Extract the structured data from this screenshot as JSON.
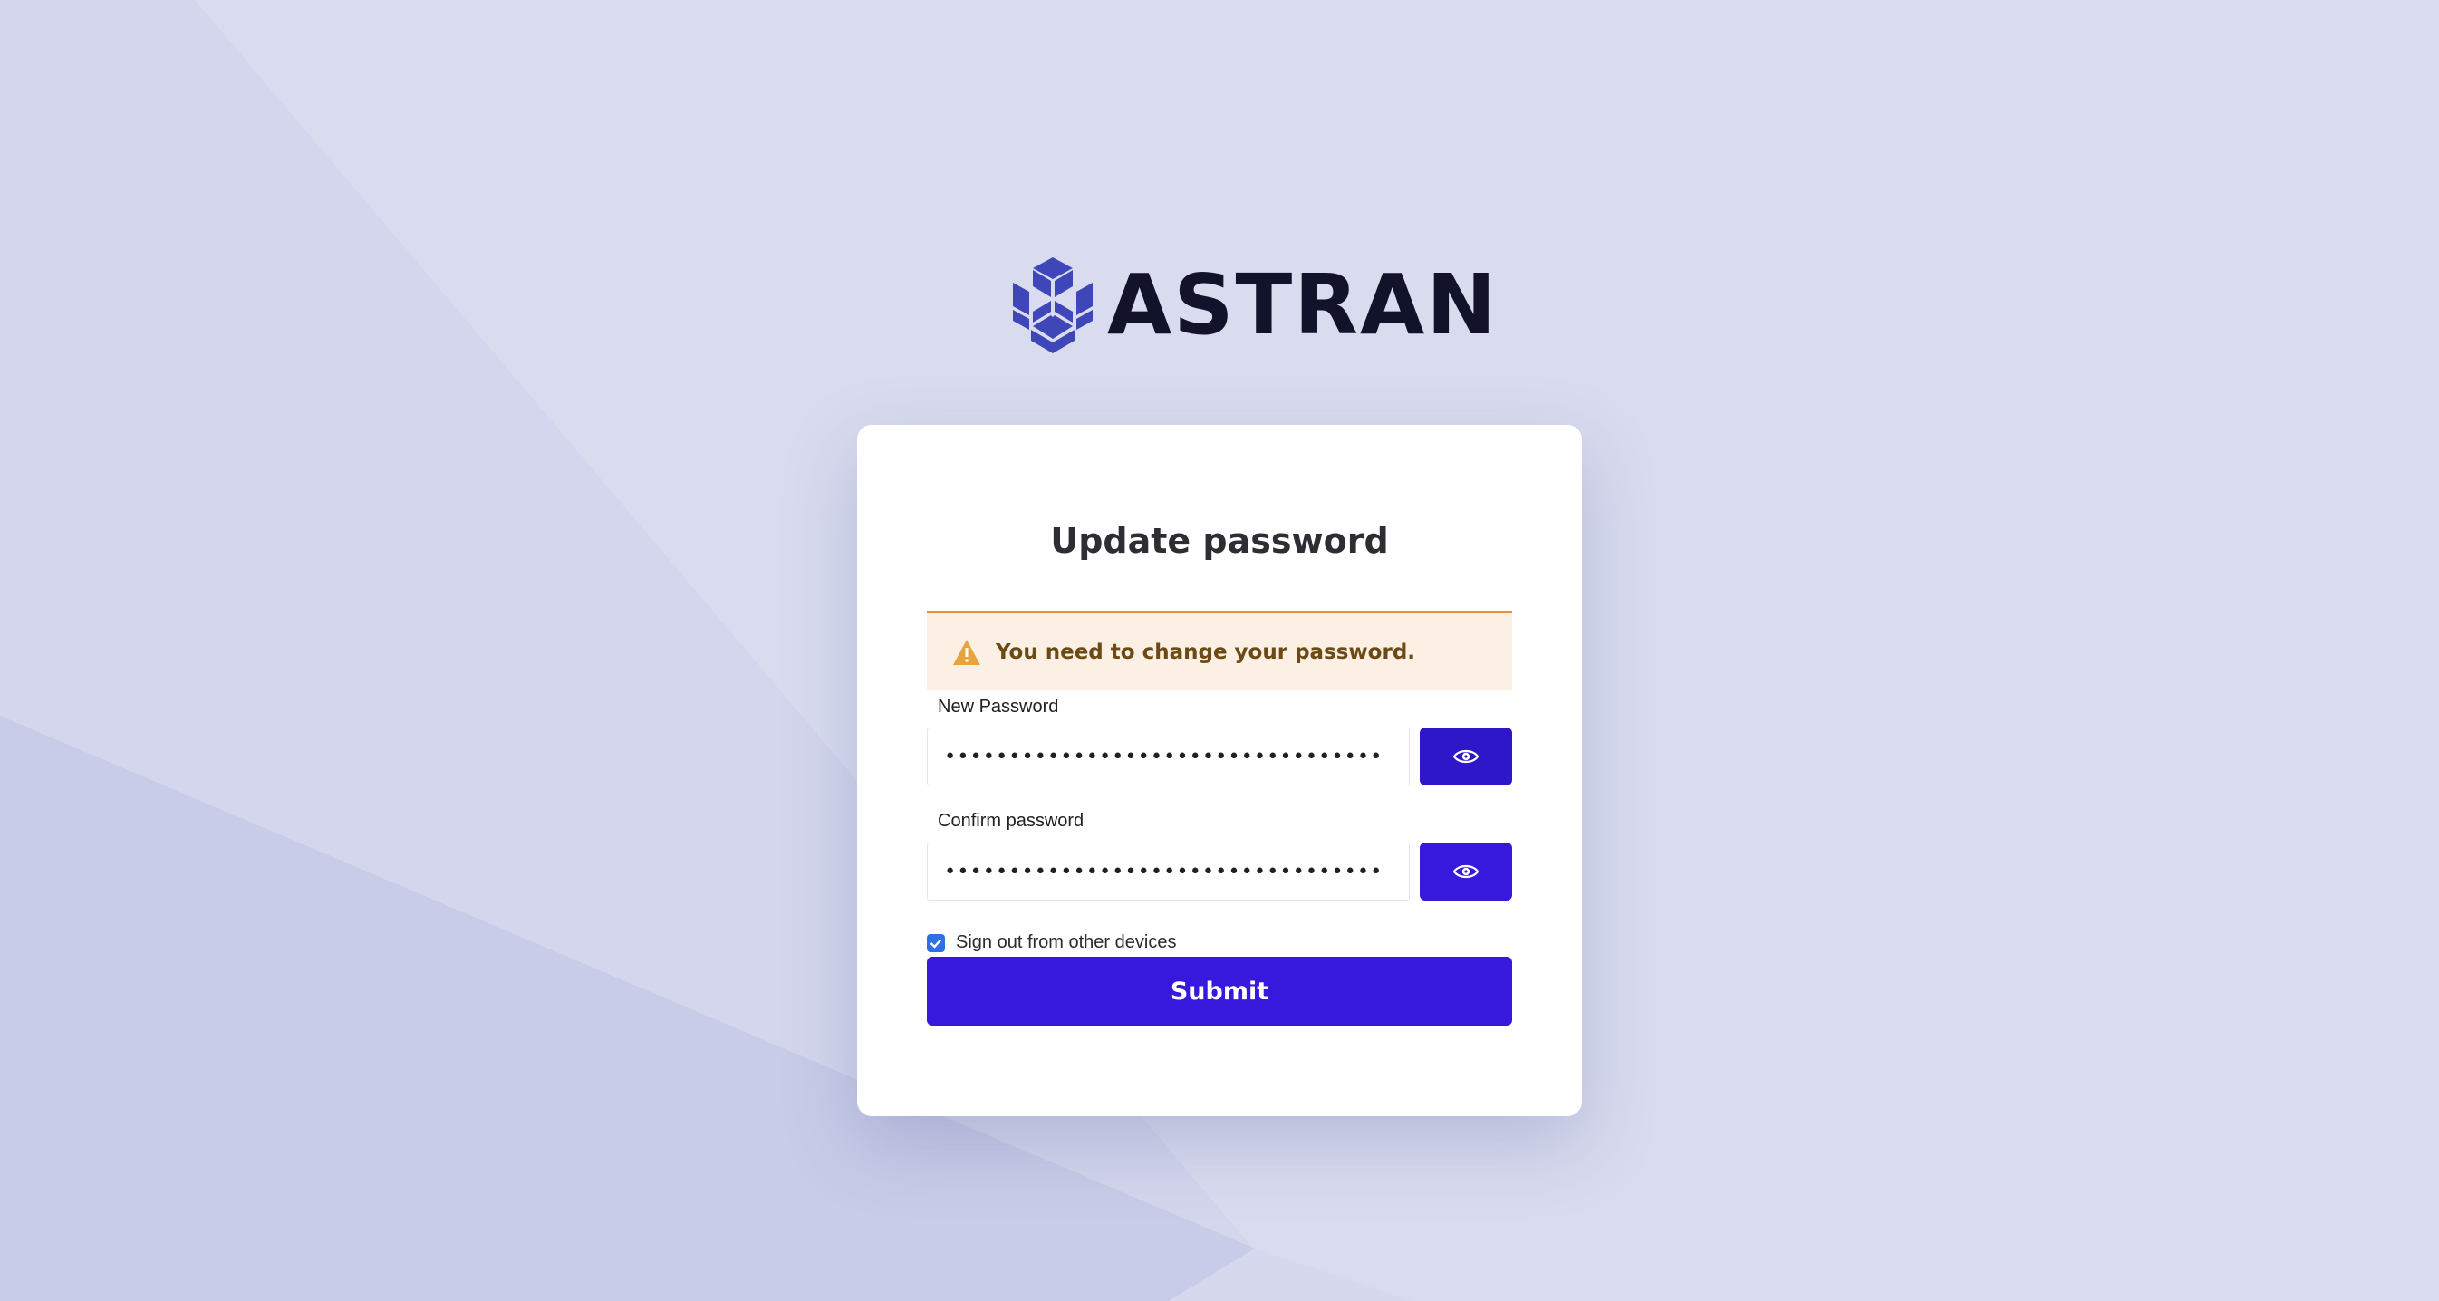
{
  "brand": {
    "name": "ASTRAN",
    "logo_icon": "hexagon-cubes-logo-icon",
    "logo_color": "#3e46b8",
    "text_color": "#12132b"
  },
  "form": {
    "title": "Update password",
    "alert": {
      "icon": "warning-triangle-icon",
      "message": "You need to change your password.",
      "color": "#e8a33c"
    },
    "new_password": {
      "label": "New Password",
      "value": "••••••••••••••••••••••••••••••••••",
      "toggle_icon": "eye-icon"
    },
    "confirm_password": {
      "label": "Confirm password",
      "value": "••••••••••••••••••••••••••••••••••",
      "toggle_icon": "eye-icon"
    },
    "sign_out_other_devices": {
      "label": "Sign out from other devices",
      "checked": true
    },
    "submit_label": "Submit"
  },
  "colors": {
    "background": "#d9dcef",
    "accent": "#3619dc",
    "alert_bg": "#fbf0e3",
    "alert_border": "#e3923a"
  }
}
